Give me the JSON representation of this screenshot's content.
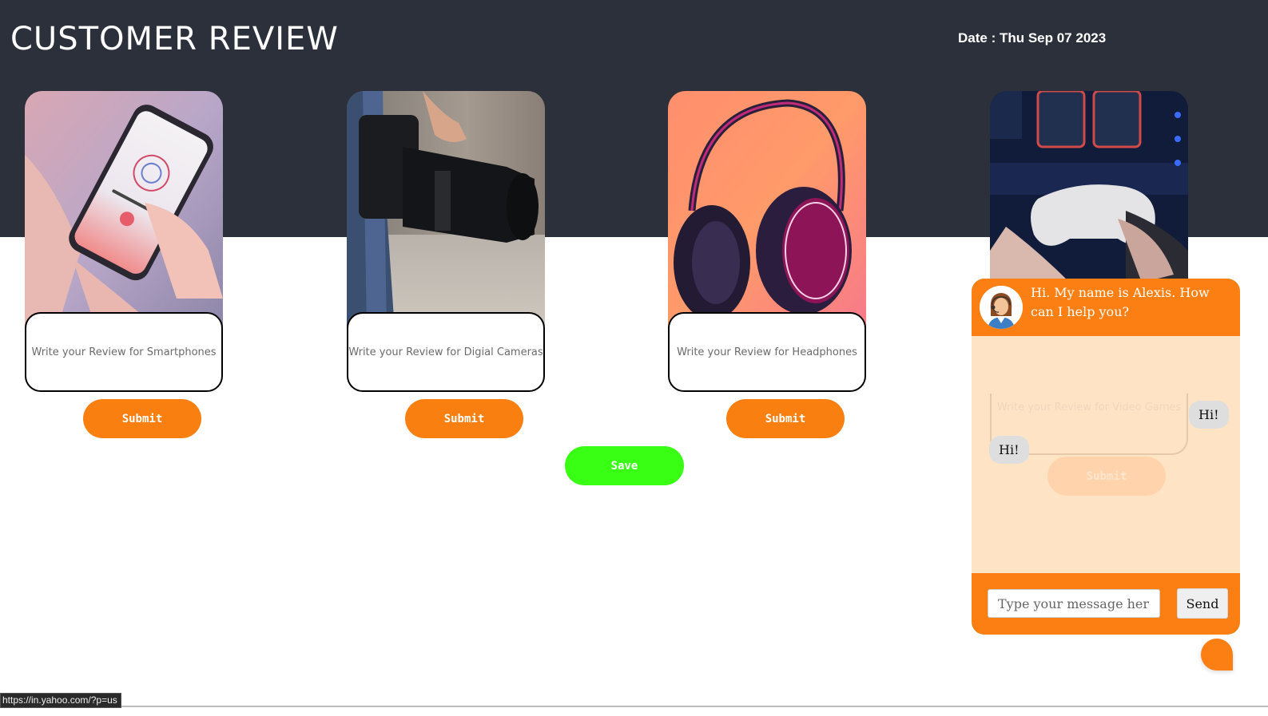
{
  "header": {
    "title": "CUSTOMER REVIEW",
    "date": "Date : Thu Sep 07 2023"
  },
  "products": [
    {
      "name": "Smartphones",
      "image_icon": "smartphone-photo",
      "placeholder": "Write your Review for Smartphones",
      "submit_label": "Submit"
    },
    {
      "name": "Digial Cameras",
      "image_icon": "camera-photo",
      "placeholder": "Write your Review for Digial Cameras",
      "submit_label": "Submit"
    },
    {
      "name": "Headphones",
      "image_icon": "headphones-photo",
      "placeholder": "Write your Review for Headphones",
      "submit_label": "Submit"
    },
    {
      "name": "Video Games",
      "image_icon": "game-controller-photo",
      "placeholder": "Write your Review for Video Games",
      "submit_label": "Submit"
    }
  ],
  "save_label": "Save",
  "chat": {
    "greeting": "Hi. My name is Alexis. How can I help you?",
    "messages": [
      {
        "from": "user",
        "text": "Hi!"
      },
      {
        "from": "bot",
        "text": "Hi!"
      }
    ],
    "input_placeholder": "Type your message here...",
    "send_label": "Send"
  },
  "status_url": "https://in.yahoo.com/?p=us",
  "colors": {
    "header_bg": "#2b303b",
    "accent_orange": "#f97f10",
    "save_green": "#39ff14",
    "chat_bg": "#ffe3c5"
  }
}
